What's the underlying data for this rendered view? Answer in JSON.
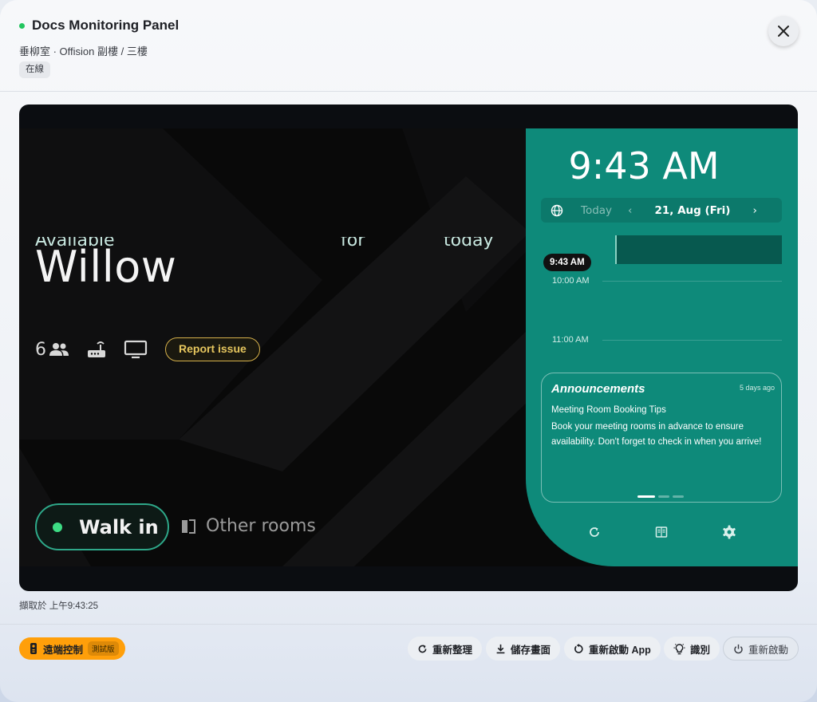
{
  "header": {
    "title": "Docs Monitoring Panel",
    "location": "垂柳室 · Offision 副樓 / 三樓",
    "status_badge": "在線"
  },
  "colors": {
    "online": "#22c55e",
    "panel_teal": "#0e8a7a",
    "remote_orange": "#ff9f0a",
    "report_gold": "#d6b14b",
    "walkin_green": "#3ddc84"
  },
  "kiosk": {
    "room_name": "Willow",
    "ghost_texts": [
      "Available",
      "for",
      "today"
    ],
    "capacity": "6",
    "report_label": "Report issue",
    "walkin_label": "Walk in",
    "other_rooms_label": "Other rooms",
    "clock": "9:43 AM",
    "date_nav": {
      "today_label": "Today",
      "date": "21, Aug (Fri)"
    },
    "schedule": {
      "now_label": "9:43 AM",
      "slots": [
        "10:00 AM",
        "11:00 AM"
      ]
    },
    "announcements": {
      "title": "Announcements",
      "age": "5 days ago",
      "heading": "Meeting Room Booking Tips",
      "body": "Book your meeting rooms in advance to ensure availability. Don't forget to check in when you arrive!"
    },
    "icons": [
      "people-icon",
      "router-icon",
      "monitor-icon",
      "door-icon",
      "globe-icon",
      "refresh-icon",
      "book-icon",
      "gear-icon"
    ]
  },
  "captured_at": "擷取於 上午9:43:25",
  "footer": {
    "remote_label": "遠端控制",
    "remote_beta": "測試版",
    "actions": {
      "refresh": "重新整理",
      "save_screen": "儲存畫面",
      "restart_app": "重新啟動 App",
      "identify": "識別",
      "reboot": "重新啟動"
    }
  }
}
